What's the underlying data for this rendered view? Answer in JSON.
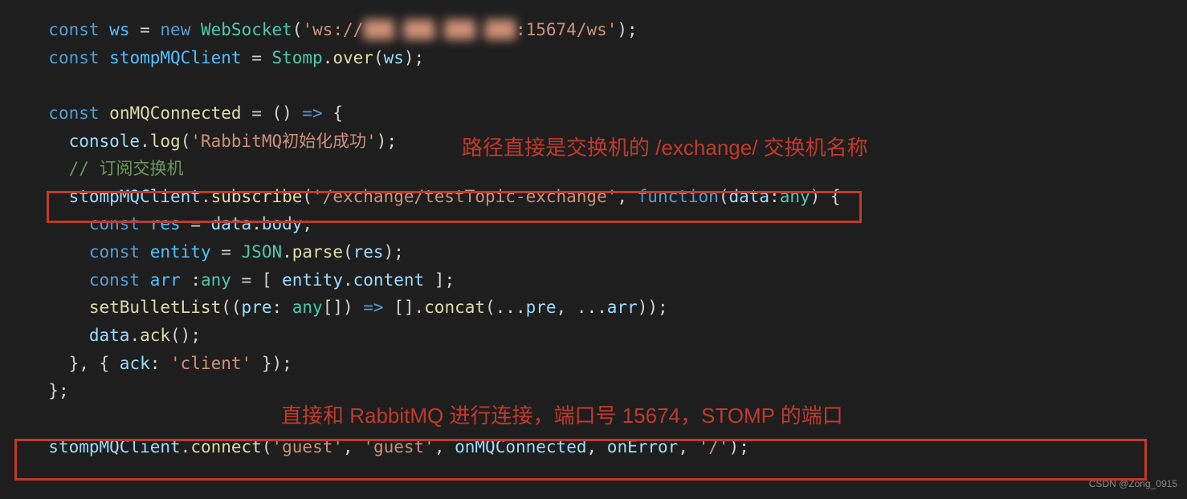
{
  "code": {
    "line1": {
      "const": "const",
      "ws": "ws",
      "eq": " = ",
      "new": "new",
      "cls": "WebSocket",
      "strPre": "'ws://",
      "strBlur": "███.███.███.███",
      "strPost": ":15674/ws'",
      "end": ");"
    },
    "line2": {
      "const": "const",
      "var": "stompMQClient",
      "eq": " = ",
      "cls": "Stomp",
      "dot": ".",
      "fn": "over",
      "arg": "ws",
      "end": ");"
    },
    "line4": {
      "const": "const",
      "var": "onMQConnected",
      "eq": " = () ",
      "arrow": "=>",
      "brace": " {"
    },
    "line5": {
      "obj": "console",
      "dot": ".",
      "fn": "log",
      "str": "'RabbitMQ初始化成功'",
      "end": ");"
    },
    "line6": {
      "cmt": "// 订阅交换机"
    },
    "line7": {
      "obj": "stompMQClient",
      "dot": ".",
      "fn": "subscribe",
      "str": "'/exchange/testTopic-exchange'",
      "comma": ", ",
      "func": "function",
      "arg": "data",
      "colon": ":",
      "type": "any",
      "end": ") {"
    },
    "line8": {
      "const": "const",
      "var": "res",
      "eq": " = ",
      "obj": "data",
      "dot": ".",
      "prop": "body",
      "end": ";"
    },
    "line9": {
      "const": "const",
      "var": "entity",
      "eq": " = ",
      "cls": "JSON",
      "dot": ".",
      "fn": "parse",
      "arg": "res",
      "end": ");"
    },
    "line10": {
      "const": "const",
      "var": "arr",
      "colon": " :",
      "type": "any",
      "eq": " = [ ",
      "obj": "entity",
      "dot": ".",
      "prop": "content",
      "end": " ];"
    },
    "line11": {
      "fn": "setBulletList",
      "open": "((",
      "arg": "pre",
      "colon": ": ",
      "type": "any",
      "arr": "[]) ",
      "arrow": "=>",
      "body": " [].",
      "concat": "concat",
      "spread": "(...",
      "pre": "pre",
      "comma": ", ...",
      "arrv": "arr",
      "end": "));"
    },
    "line12": {
      "obj": "data",
      "dot": ".",
      "fn": "ack",
      "end": "();"
    },
    "line13": {
      "close": "}, { ",
      "prop": "ack",
      "colon": ": ",
      "str": "'client'",
      "end": " });"
    },
    "line14": {
      "close": "};"
    },
    "line16": {
      "obj": "stompMQClient",
      "dot": ".",
      "fn": "connect",
      "str1": "'guest'",
      "c1": ", ",
      "str2": "'guest'",
      "c2": ", ",
      "arg1": "onMQConnected",
      "c3": ", ",
      "arg2": "onError",
      "c4": ", ",
      "str3": "'/'",
      "end": ");"
    }
  },
  "annotations": {
    "note1": "路径直接是交换机的 /exchange/ 交换机名称",
    "note2": "直接和 RabbitMQ 进行连接，端口号 15674，STOMP 的端口"
  },
  "watermark": "CSDN @Zong_0915"
}
